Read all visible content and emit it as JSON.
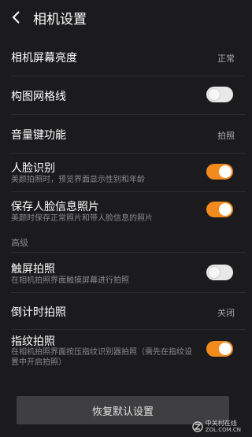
{
  "header": {
    "title": "相机设置",
    "back_icon": "back-arrow-icon"
  },
  "settings": {
    "brightness": {
      "label": "相机屏幕亮度",
      "value": "正常"
    },
    "grid": {
      "label": "构图网格线",
      "enabled": false
    },
    "volume_key": {
      "label": "音量键功能",
      "value": "拍照"
    },
    "face": {
      "label": "人脸识别",
      "desc": "美颜拍照时，预览界面显示性别和年龄",
      "enabled": true
    },
    "save_face": {
      "label": "保存人脸信息照片",
      "desc": "美颜时保存正常照片和带人脸信息的照片",
      "enabled": true
    },
    "advanced_section": "高级",
    "touch": {
      "label": "触屏拍照",
      "desc": "在相机拍照界面触摸屏幕进行拍照",
      "enabled": false
    },
    "timer": {
      "label": "倒计时拍照",
      "value": "关闭"
    },
    "fingerprint": {
      "label": "指纹拍照",
      "desc_line1": "在相机拍照界面按压指纹识别器拍照（需先在指纹设",
      "desc_line2": "置中开启拍照）",
      "enabled": true
    }
  },
  "reset_button": "恢复默认设置",
  "watermark": {
    "line1": "中关村在线",
    "line2": "ZOL.COM.CN"
  },
  "colors": {
    "toggle_on": "#f28a1e",
    "toggle_off": "#e8e8e8",
    "background": "#1b1b1d"
  }
}
